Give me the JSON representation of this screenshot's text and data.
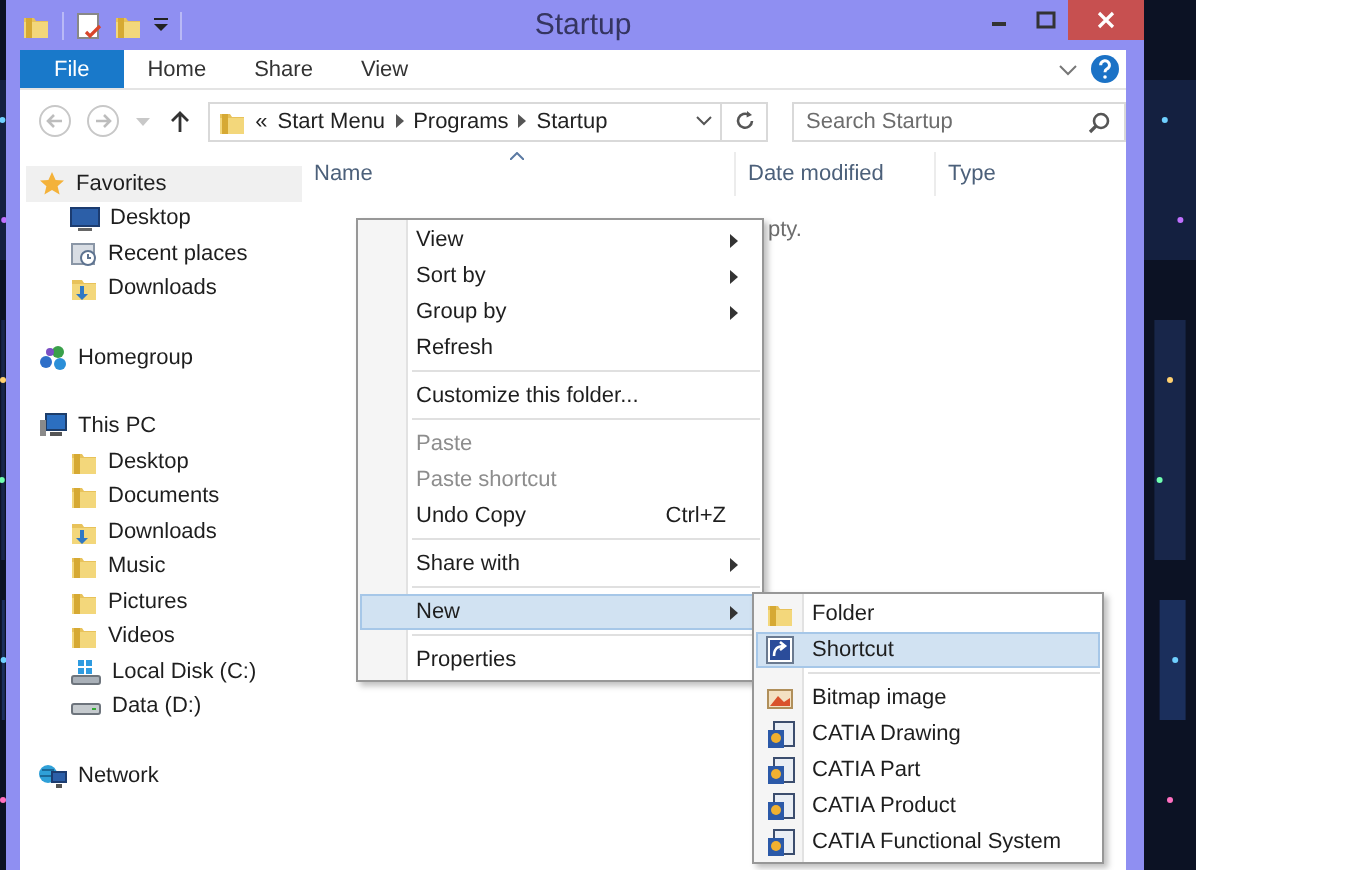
{
  "window": {
    "title": "Startup"
  },
  "ribbon": {
    "tabs": [
      {
        "label": "File",
        "selected": true
      },
      {
        "label": "Home",
        "selected": false
      },
      {
        "label": "Share",
        "selected": false
      },
      {
        "label": "View",
        "selected": false
      }
    ]
  },
  "address_bar": {
    "prefix": "«",
    "path": [
      "Start Menu",
      "Programs",
      "Startup"
    ]
  },
  "search": {
    "placeholder": "Search Startup"
  },
  "navigation": [
    {
      "label": "Favorites",
      "kind": "star",
      "selected": true,
      "children": [
        {
          "label": "Desktop",
          "kind": "monitor",
          "selected": false
        },
        {
          "label": "Recent places",
          "kind": "recent",
          "selected": false
        },
        {
          "label": "Downloads",
          "kind": "folder-down",
          "selected": false
        }
      ]
    },
    {
      "label": "Homegroup",
      "kind": "homegroup",
      "selected": false
    },
    {
      "label": "This PC",
      "kind": "computer",
      "selected": false,
      "children": [
        {
          "label": "Desktop",
          "kind": "folder",
          "selected": false
        },
        {
          "label": "Documents",
          "kind": "folder",
          "selected": false
        },
        {
          "label": "Downloads",
          "kind": "folder-down",
          "selected": false
        },
        {
          "label": "Music",
          "kind": "folder",
          "selected": false
        },
        {
          "label": "Pictures",
          "kind": "folder",
          "selected": false
        },
        {
          "label": "Videos",
          "kind": "folder",
          "selected": false
        },
        {
          "label": "Local Disk (C:)",
          "kind": "system-drive",
          "selected": false
        },
        {
          "label": "Data (D:)",
          "kind": "drive",
          "selected": false
        }
      ]
    },
    {
      "label": "Network",
      "kind": "network",
      "selected": false
    }
  ],
  "file_list": {
    "columns": [
      {
        "label": "Name",
        "sorted": true
      },
      {
        "label": "Date modified",
        "sorted": false
      },
      {
        "label": "Type",
        "sorted": false
      }
    ],
    "empty_message": "pty."
  },
  "context_menu": {
    "items": [
      {
        "kind": "item",
        "label": "View",
        "submenu": true,
        "disabled": false,
        "selected": false
      },
      {
        "kind": "item",
        "label": "Sort by",
        "submenu": true,
        "disabled": false,
        "selected": false
      },
      {
        "kind": "item",
        "label": "Group by",
        "submenu": true,
        "disabled": false,
        "selected": false
      },
      {
        "kind": "item",
        "label": "Refresh",
        "submenu": false,
        "disabled": false,
        "selected": false
      },
      {
        "kind": "separator"
      },
      {
        "kind": "item",
        "label": "Customize this folder...",
        "submenu": false,
        "disabled": false,
        "selected": false
      },
      {
        "kind": "separator"
      },
      {
        "kind": "item",
        "label": "Paste",
        "submenu": false,
        "disabled": true,
        "selected": false
      },
      {
        "kind": "item",
        "label": "Paste shortcut",
        "submenu": false,
        "disabled": true,
        "selected": false
      },
      {
        "kind": "item",
        "label": "Undo Copy",
        "shortcut": "Ctrl+Z",
        "submenu": false,
        "disabled": false,
        "selected": false
      },
      {
        "kind": "separator"
      },
      {
        "kind": "item",
        "label": "Share with",
        "submenu": true,
        "disabled": false,
        "selected": false
      },
      {
        "kind": "separator"
      },
      {
        "kind": "item",
        "label": "New",
        "submenu": true,
        "disabled": false,
        "selected": true
      },
      {
        "kind": "separator"
      },
      {
        "kind": "item",
        "label": "Properties",
        "submenu": false,
        "disabled": false,
        "selected": false
      }
    ]
  },
  "new_submenu": {
    "items": [
      {
        "kind": "folder",
        "label": "Folder",
        "selected": false
      },
      {
        "kind": "shortcut",
        "label": "Shortcut",
        "selected": true
      },
      {
        "kind": "separator"
      },
      {
        "kind": "bitmap",
        "label": "Bitmap image",
        "selected": false
      },
      {
        "kind": "catia",
        "label": "CATIA Drawing",
        "selected": false
      },
      {
        "kind": "catia",
        "label": "CATIA Part",
        "selected": false
      },
      {
        "kind": "catia",
        "label": "CATIA Product",
        "selected": false
      },
      {
        "kind": "catia",
        "label": "CATIA Functional System",
        "selected": false
      }
    ]
  }
}
